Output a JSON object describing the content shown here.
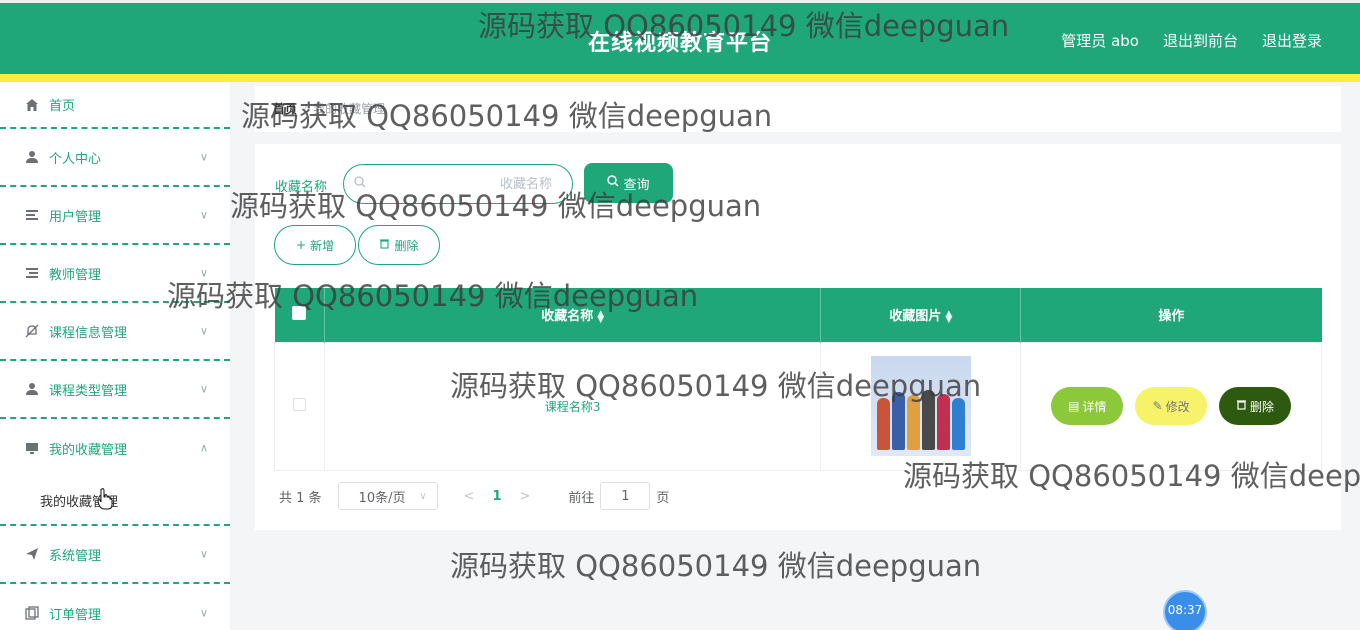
{
  "header": {
    "title": "在线视频教育平台",
    "nav": [
      "管理员 abo",
      "退出到前台",
      "退出登录"
    ]
  },
  "sidebar": {
    "items": [
      {
        "label": "首页",
        "icon": "home-icon"
      },
      {
        "label": "个人中心",
        "icon": "user-icon"
      },
      {
        "label": "用户管理",
        "icon": "list-icon"
      },
      {
        "label": "教师管理",
        "icon": "list-icon"
      },
      {
        "label": "课程信息管理",
        "icon": "bell-off-icon"
      },
      {
        "label": "课程类型管理",
        "icon": "user-icon"
      },
      {
        "label": "我的收藏管理",
        "icon": "monitor-icon"
      },
      {
        "label": "系统管理",
        "icon": "send-icon"
      },
      {
        "label": "订单管理",
        "icon": "copy-icon"
      }
    ],
    "sub_item": "我的收藏管理"
  },
  "breadcrumb": {
    "home": "首页",
    "separator": "/",
    "current": "我的收藏管理"
  },
  "search": {
    "label": "收藏名称",
    "placeholder": "收藏名称",
    "query_button": "查询"
  },
  "actions": {
    "add": "新增",
    "delete": "删除"
  },
  "table": {
    "columns": [
      "收藏名称",
      "收藏图片",
      "操作"
    ],
    "rows": [
      {
        "name": "课程名称3",
        "image": "kids-picture"
      }
    ],
    "row_buttons": {
      "detail": "详情",
      "edit": "修改",
      "remove": "删除"
    }
  },
  "pagination": {
    "total": "共 1 条",
    "page_size": "10条/页",
    "current_page": "1",
    "goto_label": "前往",
    "goto_value": "1",
    "page_suffix": "页"
  },
  "watermark": "源码获取 QQ86050149 微信deepguan",
  "clock": "08:37",
  "colors": {
    "primary": "#1fa77a",
    "accent_bar": "#f6f03a",
    "detail": "#8bc83a",
    "edit": "#f6f36a",
    "remove": "#2d5a0e"
  }
}
